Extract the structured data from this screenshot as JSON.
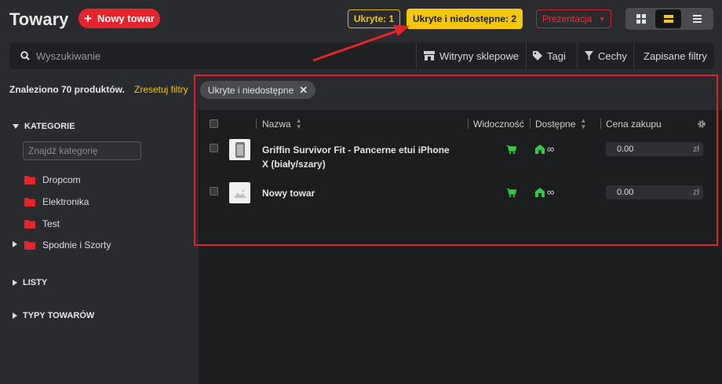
{
  "header": {
    "title": "Towary",
    "new_button_label": "Nowy towar",
    "hidden_filter_label": "Ukryte: 1",
    "hidden_unavailable_filter_label": "Ukryte i niedostępne: 2",
    "presentation_label": "Prezentacja"
  },
  "view_modes": [
    "grid-view-icon",
    "compact-view-icon",
    "list-view-icon"
  ],
  "toolbar": {
    "search_placeholder": "Wyszukiwanie",
    "stores_label": "Witryny sklepowe",
    "tags_label": "Tagi",
    "features_label": "Cechy",
    "saved_filters_label": "Zapisane filtry"
  },
  "results": {
    "found_text": "Znaleziono 70 produktów.",
    "reset_filters_label": "Zresetuj filtry",
    "active_filter_chip": "Ukryte i niedostępne"
  },
  "sidebar": {
    "categories_heading": "KATEGORIE",
    "category_search_placeholder": "Znajdź kategorię",
    "categories": [
      {
        "label": "Dropcom"
      },
      {
        "label": "Elektronika"
      },
      {
        "label": "Test"
      },
      {
        "label": "Spodnie i Szorty"
      }
    ],
    "lists_heading": "LISTY",
    "product_types_heading": "TYPY TOWARÓW"
  },
  "table": {
    "columns": {
      "name": "Nazwa",
      "visibility": "Widoczność",
      "available": "Dostępne",
      "purchase_price": "Cena zakupu"
    },
    "rows": [
      {
        "name": "Griffin Survivor Fit - Pancerne etui iPhone X (biały/szary)",
        "available": "∞",
        "price": "0.00",
        "currency": "zł"
      },
      {
        "name": "Nowy towar",
        "available": "∞",
        "price": "0.00",
        "currency": "zł"
      }
    ]
  },
  "colors": {
    "accent_red": "#e8242b",
    "accent_yellow": "#f4c70f",
    "status_green": "#2ecc40",
    "background": "#2a2b2e",
    "panel": "#1c1d1f"
  }
}
